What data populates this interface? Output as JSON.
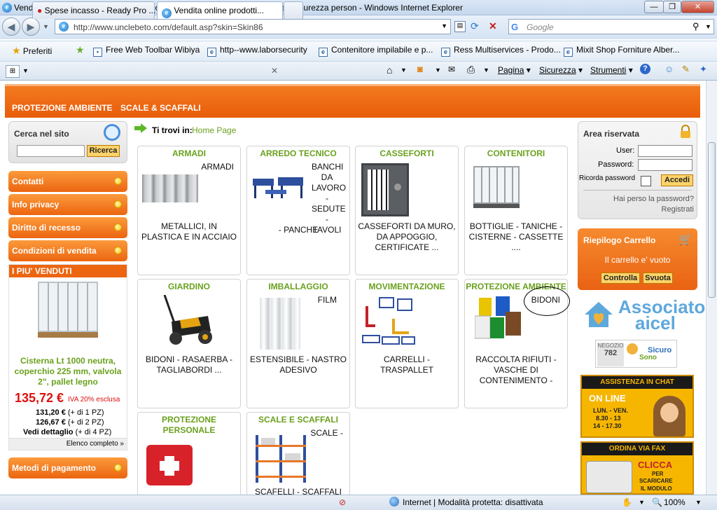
{
  "window": {
    "title": "Vendita online prodotti per il pronto soccorso, armadi in metallo e plastica , sicurezza person - Windows Internet Explorer",
    "minimize": "—",
    "restore": "❐",
    "close": "✕"
  },
  "address": {
    "url": "http://www.unclebeto.com/default.asp?skin=Skin86",
    "search_placeholder": "Google"
  },
  "favorites": {
    "label": "Preferiti",
    "items": [
      "Free Web Toolbar Wibiya",
      "http--www.laborsecurity",
      "Contenitore impilabile e p...",
      "Ress Multiservices - Prodo...",
      "Mixit Shop Forniture Alber..."
    ]
  },
  "tabs": [
    {
      "label": "Spese incasso - Ready Pro ..."
    },
    {
      "label": "Vendita online prodotti..."
    }
  ],
  "commandbar": {
    "page": "Pagina",
    "security": "Sicurezza",
    "tools": "Strumenti"
  },
  "site": {
    "topnav": [
      "PROTEZIONE AMBIENTE",
      "SCALE & SCAFFALI"
    ],
    "search": {
      "title": "Cerca nel sito",
      "button": "Ricerca"
    },
    "breadcrumb": {
      "prefix": "Ti trovi in:",
      "link": "Home Page"
    },
    "left_menu": [
      "Contatti",
      "Info privacy",
      "Diritto di recesso",
      "Condizioni di vendita"
    ],
    "bestsellers": {
      "title": "I PIU' VENDUTI",
      "product": "Cisterna Lt 1000 neutra, coperchio 225 mm, valvola 2\", pallet legno",
      "price": "135,72 €",
      "vat": "IVA 20% esclusa",
      "tiers": [
        {
          "price": "131,20 €",
          "qty": "(+ di 1 PZ)"
        },
        {
          "price": "126,67 €",
          "qty": "(+ di 2 PZ)"
        }
      ],
      "details": "Vedi dettaglio",
      "details_qty": "(+ di 4 PZ)",
      "full_list": "Elenco completo »"
    },
    "payment": "Metodi di pagamento",
    "categories": [
      {
        "title": "ARMADI",
        "line1": "ARMADI",
        "desc": "METALLICI, IN PLASTICA E IN ACCIAIO"
      },
      {
        "title": "ARREDO TECNICO",
        "line1": "BANCHI DA LAVORO - SEDUTE - TAVOLI",
        "desc": "- PANCHE"
      },
      {
        "title": "CASSEFORTI",
        "line1": "",
        "desc": "CASSEFORTI DA MURO, DA APPOGGIO, CERTIFICATE ..."
      },
      {
        "title": "CONTENITORI",
        "line1": "",
        "desc": "BOTTIGLIE - TANICHE - CISTERNE - CASSETTE ...."
      },
      {
        "title": "GIARDINO",
        "line1": "",
        "desc": "BIDONI - RASAERBA - TAGLIABORDI ..."
      },
      {
        "title": "IMBALLAGGIO",
        "line1": "FILM",
        "desc": "ESTENSIBILE - NASTRO ADESIVO"
      },
      {
        "title": "MOVIMENTAZIONE",
        "line1": "",
        "desc": "CARRELLI - TRASPALLET"
      },
      {
        "title": "PROTEZIONE AMBIENTE",
        "line1": "BIDONI",
        "desc": "RACCOLTA RIFIUTI - VASCHE DI CONTENIMENTO -"
      },
      {
        "title": "PROTEZIONE PERSONALE",
        "line1": "",
        "desc": ""
      },
      {
        "title": "SCALE E SCAFFALI",
        "line1": "SCALE -",
        "desc": "SCAFELLI - SCAFFALI"
      }
    ],
    "login": {
      "title": "Area riservata",
      "user_label": "User:",
      "password_label": "Password:",
      "remember_label": "Ricorda password",
      "submit": "Accedi",
      "forgot": "Hai perso la password?",
      "register": "Registrati"
    },
    "cart": {
      "title": "Riepilogo Carrello",
      "empty": "Il carrello e' vuoto",
      "check": "Controlla",
      "empty_btn": "Svuota"
    },
    "banners": {
      "aicel_1": "Associato",
      "aicel_2": "aicel",
      "negozio_label": "NEGOZIO",
      "negozio_num": "782",
      "sicuro": "Sicuro",
      "sono": "Sono",
      "chat_title": "ASSISTENZA IN CHAT",
      "chat_online": "ON LINE",
      "chat_days": "LUN. - VEN.",
      "chat_h1": "8.30 - 13",
      "chat_h2": "14 - 17.30",
      "fax_title": "ORDINA VIA FAX",
      "fax_click": "CLICCA",
      "fax_per": "PER",
      "fax_dl": "SCARICARE",
      "fax_mod": "IL MODULO"
    }
  },
  "status": {
    "zone": "Internet | Modalità protetta: disattivata",
    "zoom": "100%"
  }
}
